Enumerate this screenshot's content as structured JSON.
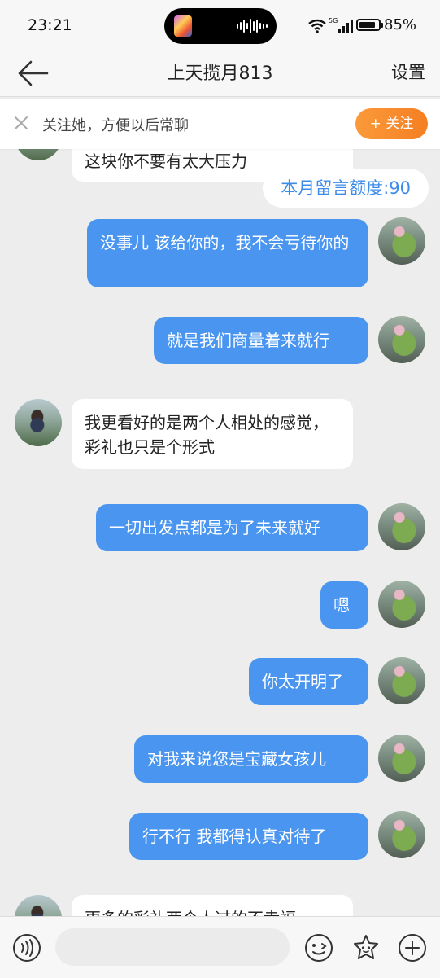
{
  "status": {
    "time": "23:21",
    "network": "5G",
    "battery": "85%",
    "battery_level": 0.85
  },
  "nav": {
    "title": "上天揽月813",
    "settings": "设置"
  },
  "follow": {
    "text": "关注她，方便以后常聊",
    "button": "+ 关注"
  },
  "quota": "本月留言额度:90",
  "messages": [
    {
      "dir": "in",
      "text": "这块你不要有太大压力"
    },
    {
      "dir": "out",
      "text": "没事儿 该给你的，我不会亏待你的"
    },
    {
      "dir": "out",
      "text": "就是我们商量着来就行"
    },
    {
      "dir": "in",
      "text": "我更看好的是两个人相处的感觉，彩礼也只是个形式"
    },
    {
      "dir": "out",
      "text": "一切出发点都是为了未来就好"
    },
    {
      "dir": "out",
      "text": "嗯"
    },
    {
      "dir": "out",
      "text": "你太开明了"
    },
    {
      "dir": "out",
      "text": "对我来说您是宝藏女孩儿"
    },
    {
      "dir": "out",
      "text": "行不行 我都得认真对待了"
    },
    {
      "dir": "in",
      "text": "更多的彩礼两个人过的不幸福"
    }
  ],
  "input": {
    "placeholder": ""
  },
  "icons": {
    "back": "back-arrow-icon",
    "close": "close-icon",
    "voice": "voice-icon",
    "emoji": "emoji-icon",
    "sticker": "sticker-icon",
    "plus": "plus-icon"
  },
  "colors": {
    "accent": "#4a95ef",
    "follow": "#f68428",
    "quota": "#3e8cea"
  }
}
